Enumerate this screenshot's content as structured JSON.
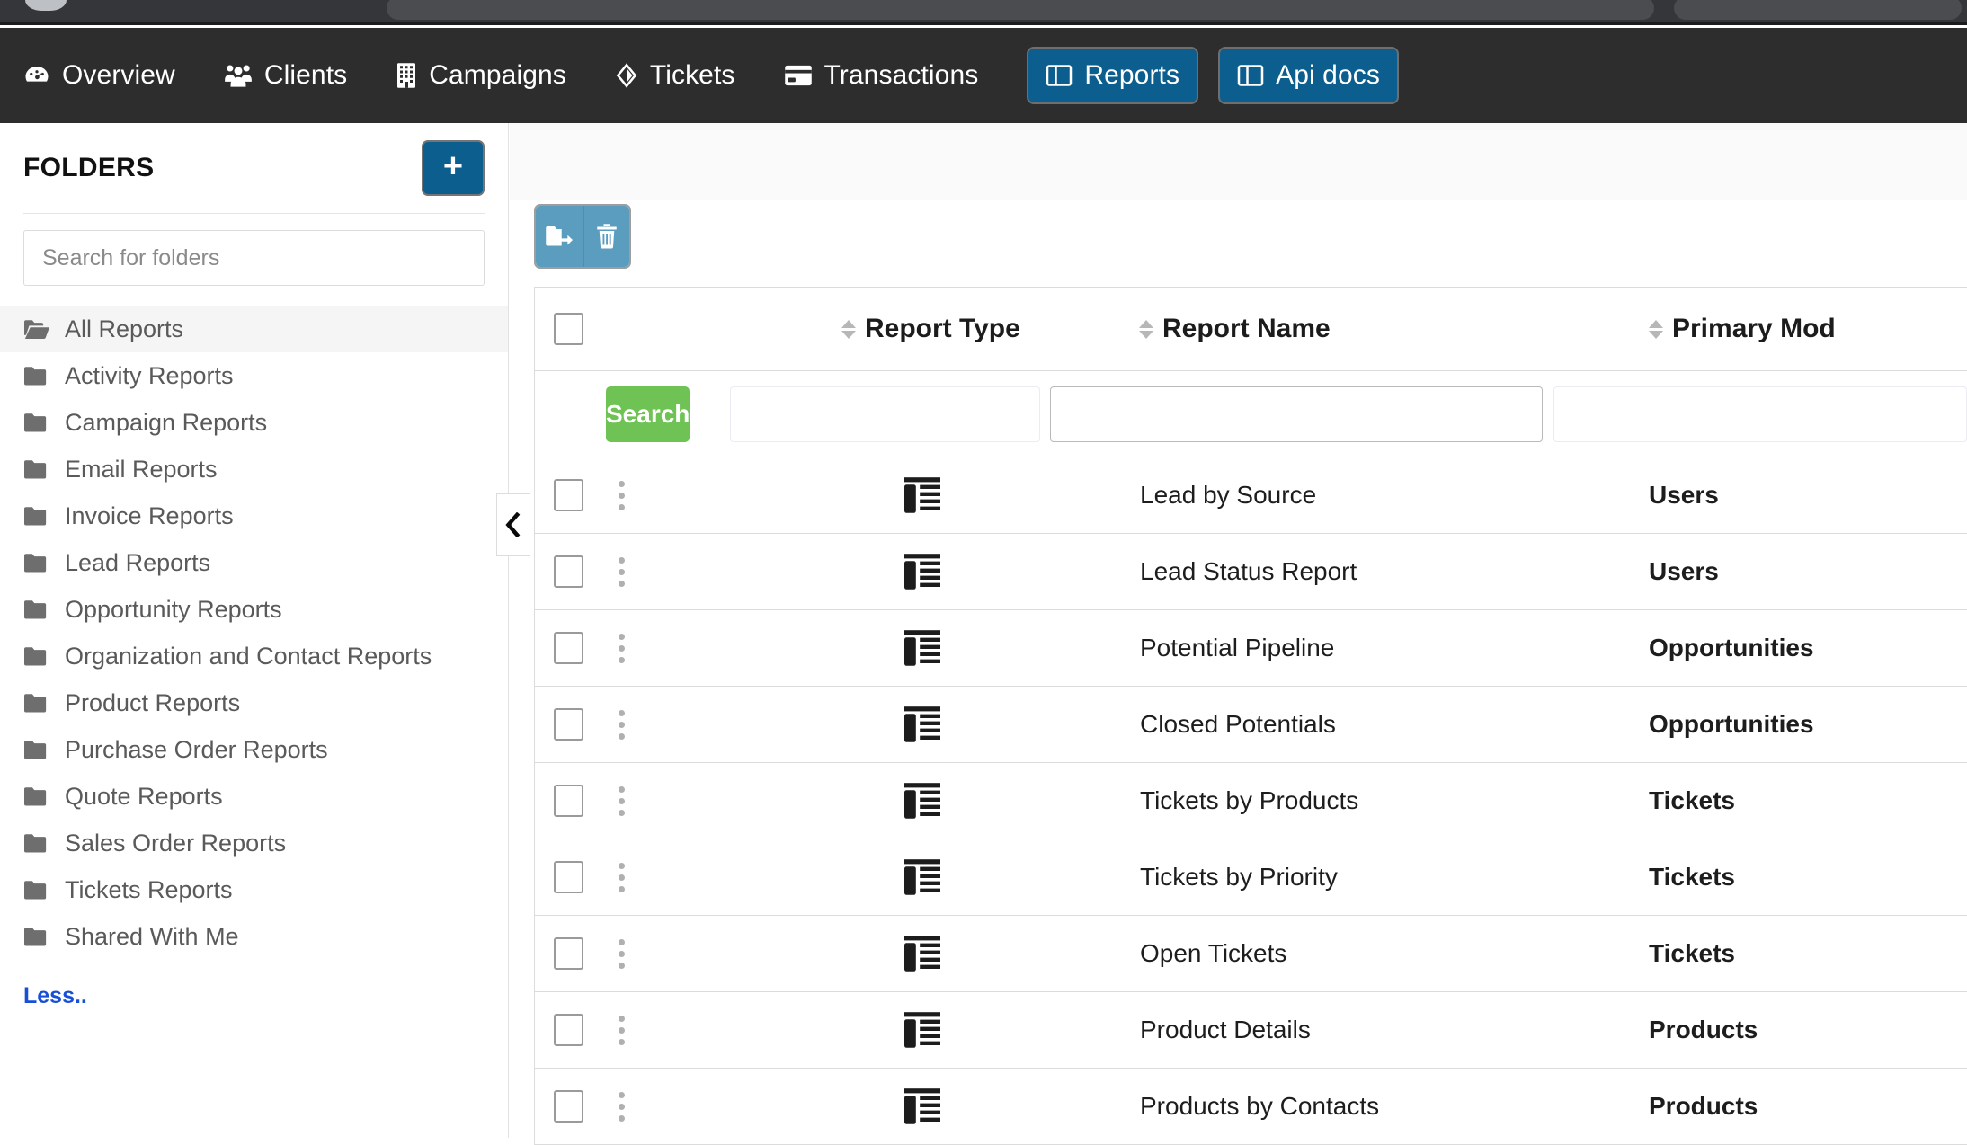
{
  "nav": {
    "items": [
      {
        "label": "Overview",
        "icon": "dashboard-icon",
        "boxed": false
      },
      {
        "label": "Clients",
        "icon": "users-icon",
        "boxed": false
      },
      {
        "label": "Campaigns",
        "icon": "building-icon",
        "boxed": false
      },
      {
        "label": "Tickets",
        "icon": "ticket-icon",
        "boxed": false
      },
      {
        "label": "Transactions",
        "icon": "credit-card-icon",
        "boxed": false
      },
      {
        "label": "Reports",
        "icon": "columns-icon",
        "boxed": true
      },
      {
        "label": "Api docs",
        "icon": "columns-icon",
        "boxed": true
      }
    ],
    "active_color": "#0c5e8e"
  },
  "sidebar": {
    "title": "FOLDERS",
    "add_button_label": "+",
    "search_placeholder": "Search for folders",
    "search_value": "",
    "items": [
      {
        "label": "All Reports",
        "icon": "folder-open-icon",
        "active": true
      },
      {
        "label": "Activity Reports",
        "icon": "folder-icon",
        "active": false
      },
      {
        "label": "Campaign Reports",
        "icon": "folder-icon",
        "active": false
      },
      {
        "label": "Email Reports",
        "icon": "folder-icon",
        "active": false
      },
      {
        "label": "Invoice Reports",
        "icon": "folder-icon",
        "active": false
      },
      {
        "label": "Lead Reports",
        "icon": "folder-icon",
        "active": false
      },
      {
        "label": "Opportunity Reports",
        "icon": "folder-icon",
        "active": false
      },
      {
        "label": "Organization and Contact Reports",
        "icon": "folder-icon",
        "active": false
      },
      {
        "label": "Product Reports",
        "icon": "folder-icon",
        "active": false
      },
      {
        "label": "Purchase Order Reports",
        "icon": "folder-icon",
        "active": false
      },
      {
        "label": "Quote Reports",
        "icon": "folder-icon",
        "active": false
      },
      {
        "label": "Sales Order Reports",
        "icon": "folder-icon",
        "active": false
      },
      {
        "label": "Tickets Reports",
        "icon": "folder-icon",
        "active": false
      },
      {
        "label": "Shared With Me",
        "icon": "folder-icon",
        "active": false
      }
    ],
    "less_link": "Less..",
    "less_link_color": "#1750d6"
  },
  "toolbar": {
    "move_to_folder_label": "move-to-folder",
    "delete_label": "delete",
    "button_color": "#5b9dbf"
  },
  "table": {
    "columns": [
      {
        "key": "report_type",
        "label": "Report Type",
        "sortable": true
      },
      {
        "key": "report_name",
        "label": "Report Name",
        "sortable": true
      },
      {
        "key": "primary_module",
        "label": "Primary Mod",
        "sortable": true
      }
    ],
    "search_button_label": "Search",
    "search_button_color": "#6fc254",
    "filters": {
      "report_type": "",
      "report_name": "",
      "primary_module": ""
    },
    "filter_placeholders": {
      "report_type": "",
      "report_name": "",
      "primary_module": ""
    },
    "select_all_checked": false,
    "rows": [
      {
        "checked": false,
        "type_icon": "tabular-report-icon",
        "report_name": "Lead by Source",
        "primary_module": "Users"
      },
      {
        "checked": false,
        "type_icon": "tabular-report-icon",
        "report_name": "Lead Status Report",
        "primary_module": "Users"
      },
      {
        "checked": false,
        "type_icon": "tabular-report-icon",
        "report_name": "Potential Pipeline",
        "primary_module": "Opportunities"
      },
      {
        "checked": false,
        "type_icon": "tabular-report-icon",
        "report_name": "Closed Potentials",
        "primary_module": "Opportunities"
      },
      {
        "checked": false,
        "type_icon": "tabular-report-icon",
        "report_name": "Tickets by Products",
        "primary_module": "Tickets"
      },
      {
        "checked": false,
        "type_icon": "tabular-report-icon",
        "report_name": "Tickets by Priority",
        "primary_module": "Tickets"
      },
      {
        "checked": false,
        "type_icon": "tabular-report-icon",
        "report_name": "Open Tickets",
        "primary_module": "Tickets"
      },
      {
        "checked": false,
        "type_icon": "tabular-report-icon",
        "report_name": "Product Details",
        "primary_module": "Products"
      },
      {
        "checked": false,
        "type_icon": "tabular-report-icon",
        "report_name": "Products by Contacts",
        "primary_module": "Products"
      }
    ]
  },
  "collapse_handle": {
    "icon": "chevron-left-icon"
  }
}
